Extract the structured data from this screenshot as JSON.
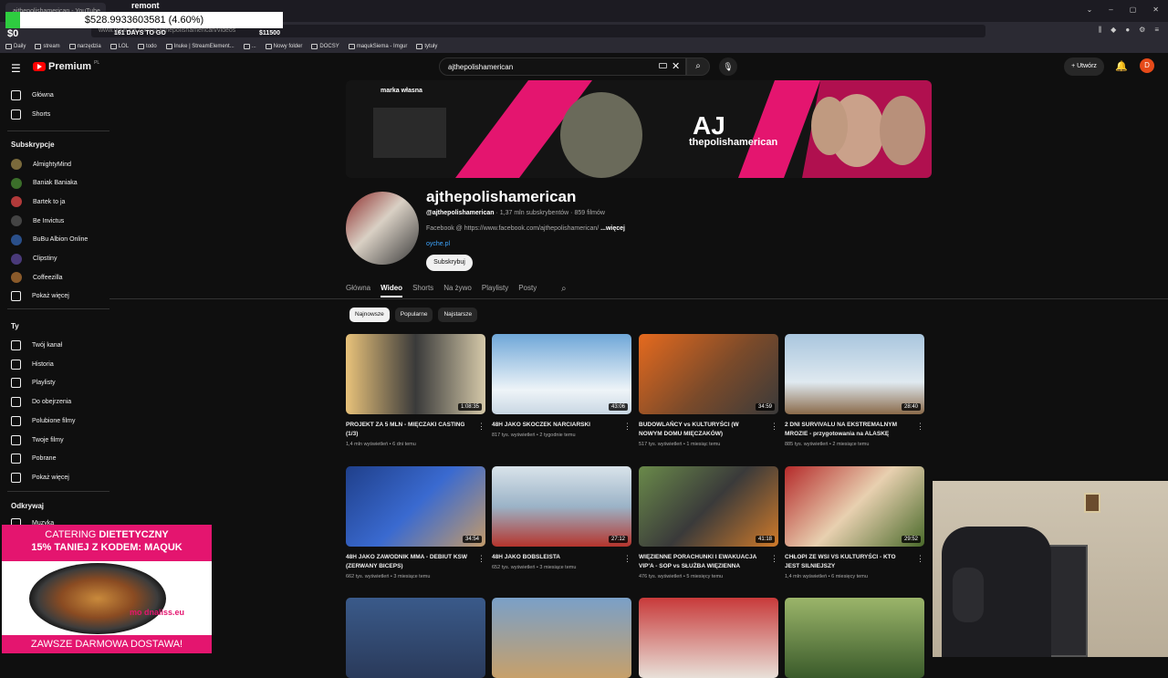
{
  "browser": {
    "tab_title": "ajthepolishamerican - YouTube",
    "url": "www.youtube.com/@ajthepolishamerican/videos",
    "bookmarks": [
      "Daily",
      "stream",
      "narzędzia",
      "LOL",
      "todo",
      "Inuke | StreamElement...",
      "...",
      "Nowy folder",
      "DOCSY",
      "maqukSiema - Imgur",
      "tytuły"
    ]
  },
  "stream_overlay": {
    "title": "remont",
    "amount": "$528.9933603581 (4.60%)",
    "zero": "$0",
    "days": "161 DAYS TO GO",
    "goal": "$11500"
  },
  "header": {
    "logo": "Premium",
    "logo_region": "PL",
    "search_value": "ajthepolishamerican",
    "create_label": "Utwórz",
    "avatar_letter": "D"
  },
  "sidebar": {
    "top": [
      {
        "label": "Główna",
        "icon": "home-icon"
      },
      {
        "label": "Shorts",
        "icon": "shorts-icon"
      }
    ],
    "subs_heading": "Subskrypcje",
    "subscriptions": [
      {
        "label": "AlmightyMind",
        "color": "#7a6a3c"
      },
      {
        "label": "Baniak Baniaka",
        "color": "#3b6e2a"
      },
      {
        "label": "Bartek to ja",
        "color": "#b23a3a"
      },
      {
        "label": "Be Invictus",
        "color": "#444444"
      },
      {
        "label": "BuBu Albion Online",
        "color": "#2a4f8a"
      },
      {
        "label": "Clipstiny",
        "color": "#4a3a7a"
      },
      {
        "label": "Coffeezilla",
        "color": "#8a5a2a"
      }
    ],
    "show_more": "Pokaż więcej",
    "you_heading": "Ty",
    "you": [
      {
        "label": "Twój kanał",
        "icon": "channel-icon"
      },
      {
        "label": "Historia",
        "icon": "history-icon"
      },
      {
        "label": "Playlisty",
        "icon": "playlists-icon"
      },
      {
        "label": "Do obejrzenia",
        "icon": "watch-later-icon"
      },
      {
        "label": "Polubione filmy",
        "icon": "liked-icon"
      },
      {
        "label": "Twoje filmy",
        "icon": "your-videos-icon"
      },
      {
        "label": "Pobrane",
        "icon": "download-icon"
      }
    ],
    "show_more2": "Pokaż więcej",
    "explore_heading": "Odkrywaj",
    "explore": [
      {
        "label": "Muzyka",
        "icon": "music-icon"
      }
    ]
  },
  "channel": {
    "name": "ajthepolishamerican",
    "handle": "@ajthepolishamerican",
    "stats": "· 1,37 mln subskrybentów · 859 filmów",
    "description": "Facebook @ https://www.facebook.com/ajthepolishamerican/",
    "more": "...więcej",
    "link": "oyche.pl",
    "subscribe": "Subskrybuj",
    "banner_brand": "marka własna",
    "banner_logo": "AJ",
    "banner_sub": "thepolishamerican"
  },
  "tabs": [
    "Główna",
    "Wideo",
    "Shorts",
    "Na żywo",
    "Playlisty",
    "Posty"
  ],
  "active_tab": "Wideo",
  "chips": [
    "Najnowsze",
    "Popularne",
    "Najstarsze"
  ],
  "videos": [
    {
      "title": "PROJEKT ZA 5 MLN - MIĘCZAKI CASTING (1/3)",
      "meta": "1,4 mln wyświetleń • 6 dni temu",
      "duration": "1:08:35",
      "bg": "linear-gradient(90deg,#e8c27a,#3a3a3a 50%,#d4c8a8)"
    },
    {
      "title": "48H JAKO SKOCZEK NARCIARSKI",
      "meta": "817 tys. wyświetleń • 2 tygodnie temu",
      "duration": "43:06",
      "bg": "linear-gradient(180deg,#6fa7d8,#eef4f8 70%,#c9d7e3)"
    },
    {
      "title": "BUDOWLAŃCY vs KULTURYŚCI (W NOWYM DOMU MIĘCZAKÓW)",
      "meta": "517 tys. wyświetleń • 1 miesiąc temu",
      "duration": "34:59",
      "bg": "linear-gradient(135deg,#e66a1e,#7a4a2a 55%,#3a3a3a)"
    },
    {
      "title": "2 DNI SURVIVALU NA EKSTREMALNYM MROZIE - przygotowania na ALASKĘ",
      "meta": "885 tys. wyświetleń • 2 miesiące temu",
      "duration": "28:40",
      "bg": "linear-gradient(180deg,#a9c6de,#dfe9f0 60%,#8a6a4a)"
    },
    {
      "title": "48H JAKO ZAWODNIK MMA - DEBIUT KSW (ZERWANY BICEPS)",
      "meta": "662 tys. wyświetleń • 3 miesiące temu",
      "duration": "34:54",
      "bg": "linear-gradient(135deg,#1f3f8a,#3a6ad0 50%,#c29a6a)"
    },
    {
      "title": "48H JAKO BOBSLEISTA",
      "meta": "652 tys. wyświetleń • 3 miesiące temu",
      "duration": "27:12",
      "bg": "linear-gradient(180deg,#d9e3ea,#9bb3c7 50%,#b5342c)"
    },
    {
      "title": "WIĘZIENNE PORACHUNKI I EWAKUACJA VIP'A - SOP vs SŁUŻBA WIĘZIENNA",
      "meta": "476 tys. wyświetleń • 5 miesięcy temu",
      "duration": "41:18",
      "bg": "linear-gradient(135deg,#6a8a4a,#3a3a3a 50%,#d07a2a)"
    },
    {
      "title": "CHŁOPI ZE WSI VS KULTURYŚCI - KTO JEST SILNIEJSZY",
      "meta": "1,4 mln wyświetleń • 6 miesięcy temu",
      "duration": "29:52",
      "bg": "linear-gradient(135deg,#b52a2a,#e8d0b0 50%,#4a6a2a)"
    },
    {
      "title": "",
      "meta": "",
      "duration": "",
      "bg": "linear-gradient(180deg,#3a5a8a,#2a3a5a)"
    },
    {
      "title": "",
      "meta": "",
      "duration": "",
      "bg": "linear-gradient(180deg,#7aa0c8,#c7a06a)"
    },
    {
      "title": "",
      "meta": "",
      "duration": "",
      "bg": "linear-gradient(180deg,#c83a3a,#e8e0d8)"
    },
    {
      "title": "",
      "meta": "",
      "duration": "",
      "bg": "linear-gradient(180deg,#9bb56a,#3a5a2a)"
    }
  ],
  "ad": {
    "line1a": "CATERING ",
    "line1b": "DIETETYCZNY",
    "line2": "15% TANIEJ Z KODEM: MAQUK",
    "brand": "mo dnaliss.eu",
    "bottom": "ZAWSZE DARMOWA DOSTAWA!"
  }
}
